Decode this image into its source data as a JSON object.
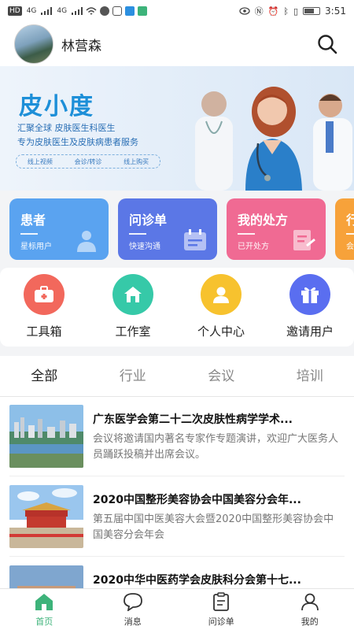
{
  "status_bar": {
    "left_chips": [
      "HD",
      "4G",
      "4G"
    ],
    "time": "3:51"
  },
  "header": {
    "username": "林营森"
  },
  "banner": {
    "title": "皮小度",
    "line1": "汇聚全球 皮肤医生科医生",
    "line2": "专为皮肤医生及皮肤病患者服务",
    "tags": [
      "线上视频",
      "会诊/转诊",
      "线上购买"
    ]
  },
  "cards": [
    {
      "title": "患者",
      "sub": "星标用户",
      "color": "#5aa3f0"
    },
    {
      "title": "问诊单",
      "sub": "快速沟通",
      "color": "#5b77e6"
    },
    {
      "title": "我的处方",
      "sub": "已开处方",
      "color": "#f06a93"
    },
    {
      "title": "行",
      "sub": "会",
      "color": "#f7a23a"
    }
  ],
  "tools": [
    {
      "label": "工具箱",
      "color": "#f2685c",
      "icon": "toolbox-icon"
    },
    {
      "label": "工作室",
      "color": "#36c9a8",
      "icon": "house-icon"
    },
    {
      "label": "个人中心",
      "color": "#f7c22e",
      "icon": "person-icon"
    },
    {
      "label": "邀请用户",
      "color": "#5a6ef0",
      "icon": "gift-icon"
    }
  ],
  "tabs": [
    "全部",
    "行业",
    "会议",
    "培训"
  ],
  "articles": [
    {
      "title": "广东医学会第二十二次皮肤性病学学术...",
      "desc": "会议将邀请国内著名专家作专题演讲，欢迎广大医务人员踊跃投稿并出席会议。"
    },
    {
      "title": "2020中国整形美容协会中国美容分会年...",
      "desc": "第五届中国中医美容大会暨2020中国整形美容协会中国美容分会年会"
    },
    {
      "title": "2020中华中医药学会皮肤科分会第十七...",
      "desc": ""
    }
  ],
  "bottom_nav": [
    {
      "label": "首页",
      "icon": "home-icon",
      "active": true
    },
    {
      "label": "消息",
      "icon": "message-icon",
      "active": false
    },
    {
      "label": "问诊单",
      "icon": "clipboard-icon",
      "active": false
    },
    {
      "label": "我的",
      "icon": "user-icon",
      "active": false
    }
  ],
  "colors": {
    "accent": "#3db37a",
    "brand_blue": "#1d8fd8"
  }
}
